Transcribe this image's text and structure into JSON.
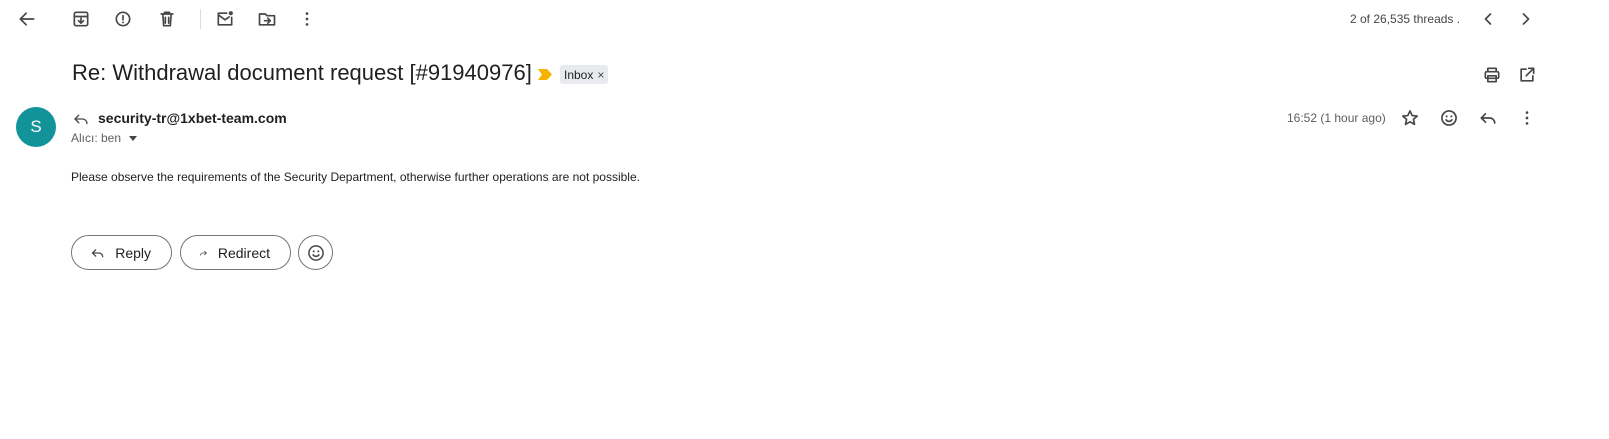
{
  "toolbar": {
    "icons": {
      "back": "arrow-left-icon",
      "archive": "archive-icon",
      "report_spam": "report-spam-icon",
      "delete": "trash-icon",
      "mark_unread": "mark-unread-icon",
      "move_to": "move-to-folder-icon",
      "more": "more-vert-icon",
      "newer": "chevron-left-icon",
      "older": "chevron-right-icon"
    },
    "thread_count": "2 of 26,535 threads ."
  },
  "message": {
    "subject": "Re: Withdrawal document request [#91940976]",
    "label": "Inbox",
    "label_remove": "×",
    "avatar_letter": "S",
    "sender": "security-tr@1xbet-team.com",
    "recipient": "Alıcı: ben",
    "timestamp": "16:52 (1 hour ago)",
    "body": "Please observe the requirements of the Security Department, otherwise further operations are not possible."
  },
  "actions": {
    "reply_label": "Reply",
    "redirect_label": "Redirect"
  },
  "colors": {
    "avatar": "#12939a",
    "importance": "#f4b400",
    "chip_bg": "#e8eaed"
  }
}
